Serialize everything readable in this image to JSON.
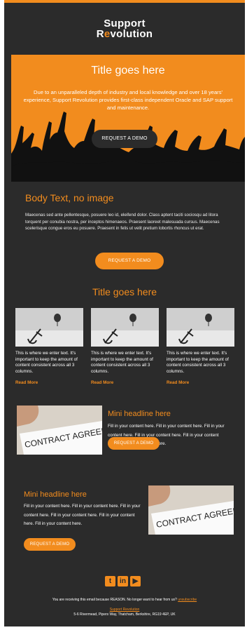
{
  "brand": {
    "logo_line1": "Support",
    "logo_line2_a": "R",
    "logo_line2_o": "e",
    "logo_line2_b": "volution",
    "accent": "#f28c1e",
    "background": "#2b2b2b"
  },
  "hero": {
    "title": "Title goes here",
    "text": "Due to an unparalleled depth of industry and local knowledge and over 18 years' experience, Support Revolution provides first-class independent Oracle and SAP support and maintenance.",
    "button": "REQUEST A DEMO"
  },
  "body": {
    "title": "Body Text, no image",
    "text": "Maecenas sed ante pellentesque, posuere leo id, eleifend dolor. Class aptent taciti sociosqu ad litora torquent per conubia nostra, per inceptos himenaeos. Praesent laoreet malesuada cursus. Maecenas scelerisque congue eros eu posuere. Praesent in felis ut velit pretium lobortis rhoncus ut erat.",
    "button": "REQUEST A DEMO"
  },
  "columns": {
    "title": "Title goes here",
    "items": [
      {
        "text": "This is where we enter text. It's important to keep the amount of content consistent across all 3 columns.",
        "link": "Read More"
      },
      {
        "text": "This is where we enter text. It's important to keep the amount of content consistent across all 3 columns.",
        "link": "Read More"
      },
      {
        "text": "This is where we enter text. It's important to keep the amount of content consistent across all 3 columns.",
        "link": "Read More"
      }
    ]
  },
  "mini1": {
    "title": "Mini headline here",
    "text": "Fill in your content here. Fill in your content here. Fill in your content here. Fill in your content here. Fill in your content here. Fill in your content here.",
    "button": "REQUEST A DEMO",
    "image_text": "CONTRACT AGREEM"
  },
  "mini2": {
    "title": "Mini headline here",
    "text": "Fill in your content here. Fill in your content here. Fill in your content here. Fill in your content here. Fill in your content here. Fill in your content here.",
    "button": "REQUEST A DEMO",
    "image_text": "CONTRACT AGREEM"
  },
  "social": {
    "icons": [
      "twitter-icon",
      "linkedin-icon",
      "youtube-icon"
    ]
  },
  "footer": {
    "notice": "You are receiving this email because REASON. No longer want to hear from us?",
    "unsubscribe": "unsubscribe",
    "company_link": "Support Revolution",
    "address": "5-6 Rivermead, Pipers Way, Thatcham, Berkshire, RG19 4EP, UK"
  }
}
